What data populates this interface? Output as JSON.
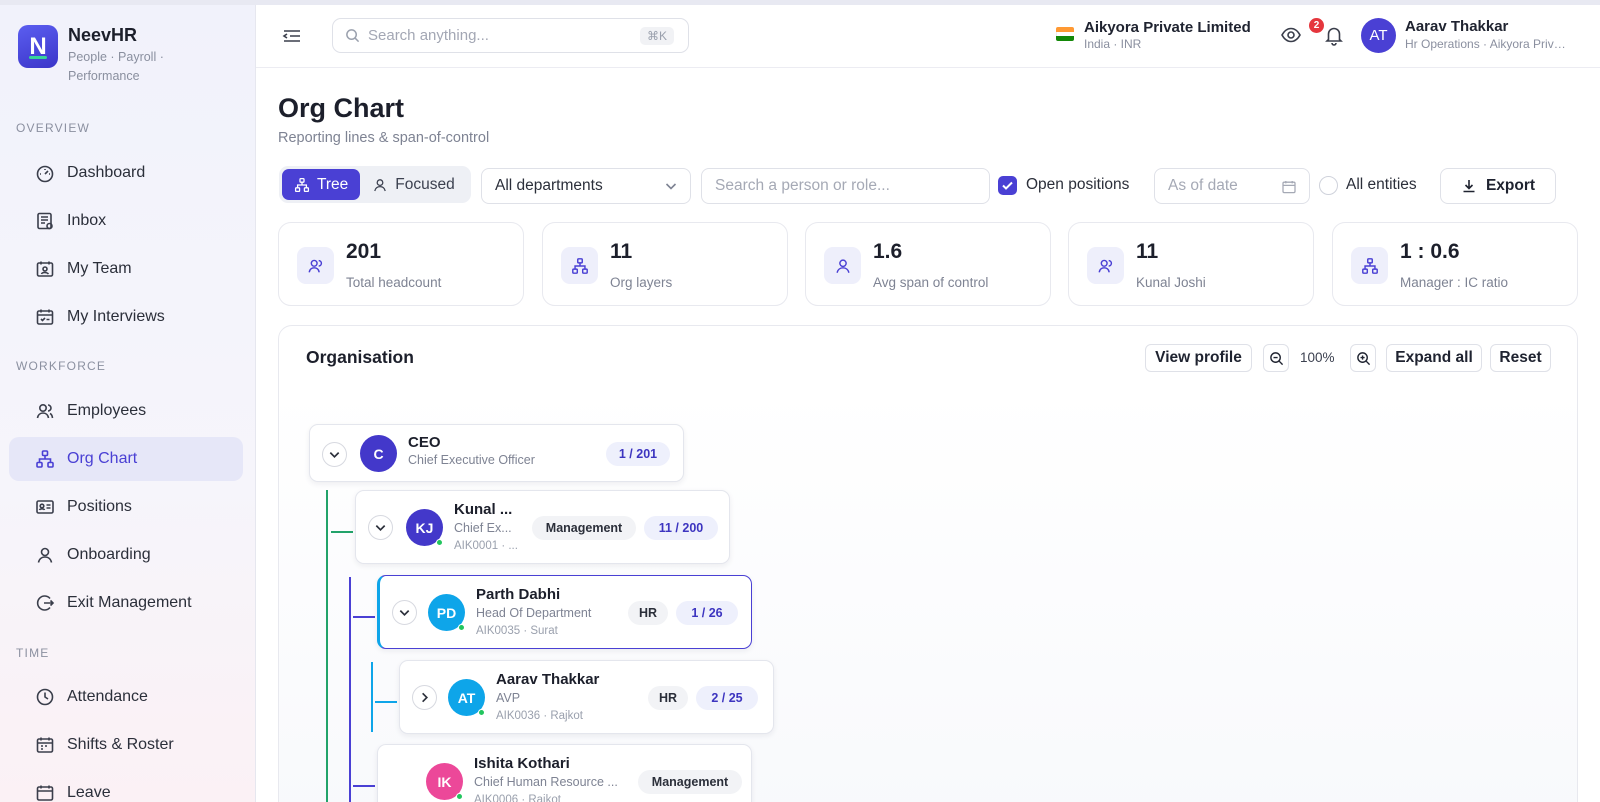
{
  "brand": {
    "name": "NeevHR",
    "tagline": "People · Payroll · Performance",
    "logo_letter": "N"
  },
  "sidebar": {
    "sections": {
      "overview": "OVERVIEW",
      "workforce": "WORKFORCE",
      "time": "TIME"
    },
    "items": [
      {
        "label": "Dashboard",
        "icon": "gauge-icon"
      },
      {
        "label": "Inbox",
        "icon": "inbox-icon"
      },
      {
        "label": "My Team",
        "icon": "team-board-icon"
      },
      {
        "label": "My Interviews",
        "icon": "calendar-check-icon"
      },
      {
        "label": "Employees",
        "icon": "users-icon"
      },
      {
        "label": "Org Chart",
        "icon": "org-chart-icon",
        "active": true
      },
      {
        "label": "Positions",
        "icon": "id-card-icon"
      },
      {
        "label": "Onboarding",
        "icon": "user-icon"
      },
      {
        "label": "Exit Management",
        "icon": "exit-icon"
      },
      {
        "label": "Attendance",
        "icon": "clock-icon"
      },
      {
        "label": "Shifts & Roster",
        "icon": "calendar-icon"
      },
      {
        "label": "Leave",
        "icon": "calendar-icon"
      }
    ]
  },
  "topbar": {
    "search_placeholder": "Search anything...",
    "search_shortcut": "⌘K",
    "company_name": "Aikyora Private Limited",
    "company_sub": "India · INR",
    "notification_count": "2",
    "user_initials": "AT",
    "user_name": "Aarav Thakkar",
    "user_role": "Hr Operations · Aikyora Private Limited"
  },
  "page": {
    "title": "Org Chart",
    "subtitle": "Reporting lines & span-of-control"
  },
  "filters": {
    "view_tree": "Tree",
    "view_focused": "Focused",
    "department": "All departments",
    "person_placeholder": "Search a person or role...",
    "open_positions": "Open positions",
    "open_positions_checked": true,
    "date_placeholder": "As of date",
    "all_entities": "All entities",
    "all_entities_checked": false,
    "export": "Export"
  },
  "stats": [
    {
      "value": "201",
      "label": "Total headcount",
      "icon": "users-icon"
    },
    {
      "value": "11",
      "label": "Org layers",
      "icon": "org-chart-icon"
    },
    {
      "value": "1.6",
      "label": "Avg span of control",
      "icon": "user-icon"
    },
    {
      "value": "11",
      "label": "Kunal Joshi",
      "icon": "users-icon"
    },
    {
      "value": "1 : 0.6",
      "label": "Manager : IC ratio",
      "icon": "org-chart-icon"
    }
  ],
  "org": {
    "title": "Organisation",
    "view_profile": "View profile",
    "zoom": "100%",
    "expand_all": "Expand all",
    "reset": "Reset",
    "nodes": [
      {
        "initials": "C",
        "name": "CEO",
        "role": "Chief Executive Officer",
        "meta": "",
        "dept": "",
        "count": "1 / 201",
        "color": "#4338ca",
        "toggle": "expanded"
      },
      {
        "initials": "KJ",
        "name": "Kunal ...",
        "role": "Chief Ex...",
        "meta": "AIK0001 · ...",
        "dept": "Management",
        "count": "11 / 200",
        "color": "#4338ca",
        "toggle": "expanded"
      },
      {
        "initials": "PD",
        "name": "Parth Dabhi",
        "role": "Head Of Department",
        "meta": "AIK0035 · Surat",
        "dept": "HR",
        "count": "1 / 26",
        "color": "#0ea5e9",
        "toggle": "expanded"
      },
      {
        "initials": "AT",
        "name": "Aarav Thakkar",
        "role": "AVP",
        "meta": "AIK0036 · Rajkot",
        "dept": "HR",
        "count": "2 / 25",
        "color": "#0ea5e9",
        "toggle": "collapsed"
      },
      {
        "initials": "IK",
        "name": "Ishita Kothari",
        "role": "Chief Human Resource ...",
        "meta": "AIK0006 · Rajkot",
        "dept": "Management",
        "count": "",
        "color": "#ec4899",
        "toggle": "none"
      }
    ]
  },
  "colors": {
    "accent": "#4a40d4",
    "online": "#22c55e",
    "line_green": "#22a36a",
    "line_blue": "#4a40d4",
    "line_sky": "#0ea5e9",
    "badge": "#e5363d"
  }
}
